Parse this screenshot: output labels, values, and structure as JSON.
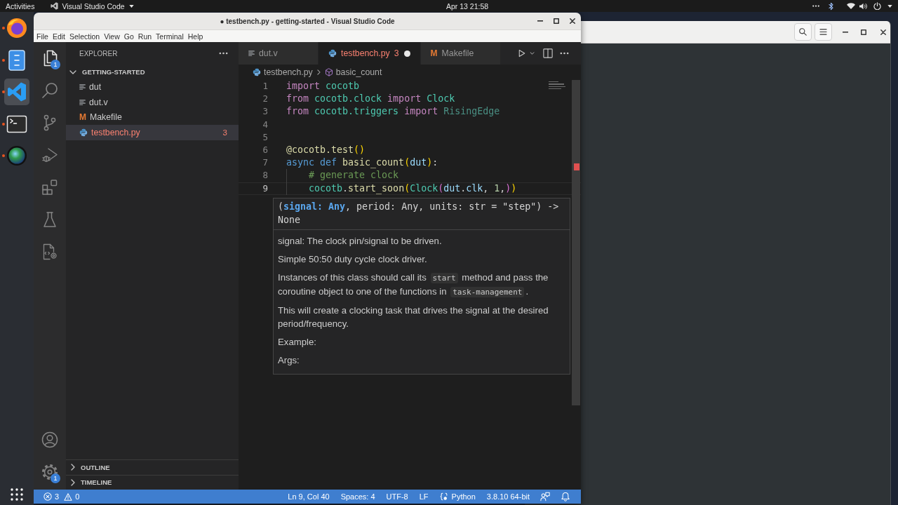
{
  "top_bar": {
    "activities": "Activities",
    "app_menu": "Visual Studio Code",
    "clock": "Apr 13 21:58"
  },
  "dock": {
    "apps": [
      {
        "kind": "browser",
        "running": true,
        "selected": false
      },
      {
        "kind": "files",
        "running": true,
        "selected": false
      },
      {
        "kind": "editor",
        "running": true,
        "selected": true
      },
      {
        "kind": "terminal",
        "running": true,
        "selected": false
      },
      {
        "kind": "globe",
        "running": true,
        "selected": false
      }
    ]
  },
  "window": {
    "title": "● testbench.py - getting-started - Visual Studio Code",
    "menu": [
      "File",
      "Edit",
      "Selection",
      "View",
      "Go",
      "Run",
      "Terminal",
      "Help"
    ]
  },
  "activity_bar": {
    "items": [
      {
        "kind": "explorer",
        "selected": true,
        "badge": "1"
      },
      {
        "kind": "search",
        "selected": false
      },
      {
        "kind": "source_control",
        "selected": false
      },
      {
        "kind": "run_debug",
        "selected": false
      },
      {
        "kind": "extensions",
        "selected": false
      },
      {
        "kind": "testing",
        "selected": false
      },
      {
        "kind": "test_file",
        "selected": false
      }
    ],
    "bottom_items": [
      {
        "kind": "accounts"
      },
      {
        "kind": "manage",
        "badge": "1"
      }
    ]
  },
  "sidebar": {
    "title": "EXPLORER",
    "section": {
      "label": "GETTING-STARTED",
      "expanded": true,
      "files": [
        {
          "name": "dut",
          "kind": "text",
          "selected": false,
          "error": false
        },
        {
          "name": "dut.v",
          "kind": "text",
          "selected": false,
          "error": false
        },
        {
          "name": "Makefile",
          "kind": "makefile",
          "icon": "M",
          "selected": false,
          "error": false
        },
        {
          "name": "testbench.py",
          "kind": "python",
          "selected": true,
          "error": true,
          "problems": "3"
        }
      ]
    },
    "panels": [
      {
        "label": "OUTLINE",
        "expanded": false
      },
      {
        "label": "TIMELINE",
        "expanded": false
      }
    ]
  },
  "editor": {
    "tabs": [
      {
        "label": "dut.v",
        "kind": "text",
        "selected": false,
        "error": false,
        "modified": false
      },
      {
        "label": "testbench.py",
        "kind": "python",
        "selected": true,
        "error": true,
        "problems": "3",
        "modified": true
      },
      {
        "label": "Makefile",
        "kind": "makefile",
        "icon": "M",
        "selected": false,
        "error": false,
        "modified": false
      }
    ],
    "breadcrumb": [
      {
        "label": "testbench.py",
        "kind": "python"
      },
      {
        "label": "basic_count",
        "kind": "function"
      }
    ],
    "lines": [
      {
        "number": "1",
        "current": false,
        "tokens": [
          {
            "text": "import ",
            "kind": "keyword"
          },
          {
            "text": "cocotb",
            "kind": "namespace"
          }
        ]
      },
      {
        "number": "2",
        "current": false,
        "tokens": [
          {
            "text": "from ",
            "kind": "keyword"
          },
          {
            "text": "cocotb.clock ",
            "kind": "namespace"
          },
          {
            "text": "import ",
            "kind": "keyword"
          },
          {
            "text": "Clock",
            "kind": "class"
          }
        ]
      },
      {
        "number": "3",
        "current": false,
        "tokens": [
          {
            "text": "from ",
            "kind": "keyword"
          },
          {
            "text": "cocotb.triggers ",
            "kind": "namespace"
          },
          {
            "text": "import ",
            "kind": "keyword"
          },
          {
            "text": "RisingEdge",
            "kind": "unused"
          }
        ]
      },
      {
        "number": "4",
        "current": false
      },
      {
        "number": "5",
        "current": false
      },
      {
        "number": "6",
        "current": false,
        "tokens": [
          {
            "text": "@cocotb.test",
            "kind": "decorator"
          },
          {
            "text": "()",
            "kind": "bracket1"
          }
        ]
      },
      {
        "number": "7",
        "current": false,
        "tokens": [
          {
            "text": "async def ",
            "kind": "storage"
          },
          {
            "text": "basic_count",
            "kind": "function"
          },
          {
            "text": "(",
            "kind": "bracket1"
          },
          {
            "text": "dut",
            "kind": "variable"
          },
          {
            "text": ")",
            "kind": "bracket1"
          },
          {
            "text": ":",
            "kind": "plain"
          }
        ],
        "children": [
          {
            "number": "8",
            "current": false,
            "tokens": [
              {
                "text": "# generate clock",
                "kind": "comment"
              }
            ]
          },
          {
            "number": "9",
            "current": true,
            "tokens": [
              {
                "text": "cocotb",
                "kind": "namespace"
              },
              {
                "text": ".",
                "kind": "plain"
              },
              {
                "text": "start_soon",
                "kind": "function"
              },
              {
                "text": "(",
                "kind": "bracket1"
              },
              {
                "text": "Clock",
                "kind": "class"
              },
              {
                "text": "(",
                "kind": "bracket2"
              },
              {
                "text": "dut",
                "kind": "variable"
              },
              {
                "text": ".",
                "kind": "plain"
              },
              {
                "text": "clk",
                "kind": "variable"
              },
              {
                "text": ", ",
                "kind": "plain"
              },
              {
                "text": "1",
                "kind": "number"
              },
              {
                "text": ",",
                "kind": "plain"
              },
              {
                "text": ")",
                "kind": "bracket2"
              },
              {
                "text": ")",
                "kind": "bracket1"
              }
            ]
          }
        ]
      }
    ],
    "hover": {
      "signature": "(**signal: Any**, period: Any, units: str = \"step\") -> None",
      "paragraphs": [
        {
          "segments": [
            {
              "kind": "text",
              "text": "signal: The clock pin/signal to be driven."
            }
          ]
        },
        {
          "segments": [
            {
              "kind": "text",
              "text": "Simple 50:50 duty cycle clock driver."
            }
          ]
        },
        {
          "segments": [
            {
              "kind": "text",
              "text": "Instances of this class should call its "
            },
            {
              "kind": "code",
              "text": "start"
            },
            {
              "kind": "text",
              "text": " method and pass the coroutine object to one of the functions in "
            },
            {
              "kind": "code",
              "text": "task-management"
            },
            {
              "kind": "text",
              "text": "."
            }
          ]
        },
        {
          "segments": [
            {
              "kind": "text",
              "text": "This will create a clocking task that drives the signal at the desired period/frequency."
            }
          ]
        },
        {
          "segments": [
            {
              "kind": "text",
              "text": "Example:"
            }
          ]
        },
        {
          "segments": [
            {
              "kind": "text",
              "text": "Args:"
            }
          ]
        }
      ]
    }
  },
  "status_bar": {
    "errors": "3",
    "warnings": "0",
    "items": [
      {
        "label": "Ln 9, Col 40",
        "kind": "text"
      },
      {
        "label": "Spaces: 4",
        "kind": "text"
      },
      {
        "label": "UTF-8",
        "kind": "text"
      },
      {
        "label": "LF",
        "kind": "text"
      },
      {
        "label": "Python",
        "kind": "language"
      },
      {
        "label": "3.8.10 64-bit",
        "kind": "text"
      }
    ]
  }
}
